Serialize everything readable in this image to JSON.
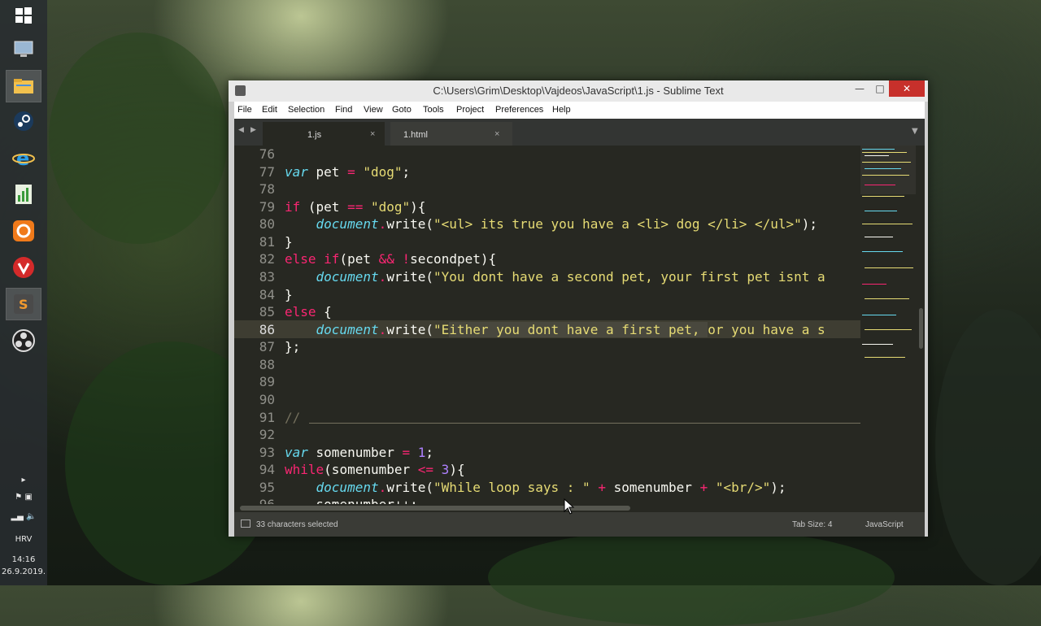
{
  "window": {
    "title": "C:\\Users\\Grim\\Desktop\\Vajdeos\\JavaScript\\1.js - Sublime Text",
    "minimize": "—",
    "maximize": "□",
    "close": "✕"
  },
  "menu": [
    "File",
    "Edit",
    "Selection",
    "Find",
    "View",
    "Goto",
    "Tools",
    "Project",
    "Preferences",
    "Help"
  ],
  "tabs": [
    {
      "label": "1.js",
      "close": "×",
      "active": true
    },
    {
      "label": "1.html",
      "close": "×",
      "active": false
    }
  ],
  "tab_nav": {
    "left": "◀",
    "right": "▶",
    "dropdown": "▼"
  },
  "editor": {
    "line_numbers": [
      "76",
      "77",
      "78",
      "79",
      "80",
      "81",
      "82",
      "83",
      "84",
      "85",
      "86",
      "87",
      "88",
      "89",
      "90",
      "91",
      "92",
      "93",
      "94",
      "95",
      "96"
    ],
    "current_line": "86",
    "selection_info": "33 characters selected"
  },
  "code": {
    "l77": {
      "kw": "var",
      "id": " pet ",
      "op": "=",
      "sp": " ",
      "str": "\"dog\"",
      "end": ";"
    },
    "l79": {
      "kw": "if",
      "a": " (pet ",
      "op": "==",
      "sp": " ",
      "str": "\"dog\"",
      "end": "){"
    },
    "l80": {
      "indent": "    ",
      "obj": "document",
      "dot": ".",
      "fn": "write(",
      "str": "\"<ul> its true you have a <li> dog </li> </ul>\"",
      "end": ");"
    },
    "l81": "}",
    "l82": {
      "kw1": "else",
      "sp": " ",
      "kw2": "if",
      "a": "(pet ",
      "op1": "&&",
      "sp2": " ",
      "op2": "!",
      "b": "secondpet){"
    },
    "l83": {
      "indent": "    ",
      "obj": "document",
      "dot": ".",
      "fn": "write(",
      "str": "\"You dont have a second pet, your first pet isnt a"
    },
    "l84": "}",
    "l85": {
      "kw": "else",
      "end": " {"
    },
    "l86": {
      "indent": "    ",
      "obj": "document",
      "dot": ".",
      "fn": "write(",
      "str_a": "\"E",
      "str_sel": "ither you dont have a first pet, ",
      "str_b": "or you have a s"
    },
    "l87": "};",
    "l91": {
      "cmt": "//"
    },
    "l93": {
      "kw": "var",
      "id": " somenumber ",
      "op": "=",
      "sp": " ",
      "num": "1",
      "end": ";"
    },
    "l94": {
      "kw": "while",
      "a": "(somenumber ",
      "op": "<=",
      "sp": " ",
      "num": "3",
      "end": "){"
    },
    "l95": {
      "indent": "    ",
      "obj": "document",
      "dot": ".",
      "fn": "write(",
      "str1": "\"While loop says : \"",
      "sp1": " ",
      "op1": "+",
      "id": " somenumber ",
      "op2": "+",
      "sp2": " ",
      "str2": "\"<br/>\"",
      "end": ");"
    },
    "l96": {
      "indent": "    ",
      "id": "somenumber++;"
    }
  },
  "status": {
    "selection": "33 characters selected",
    "tab_size": "Tab Size: 4",
    "syntax": "JavaScript"
  },
  "taskbar": {
    "icons": [
      "windows-start-icon",
      "monitor-icon",
      "file-explorer-icon",
      "steam-icon",
      "internet-explorer-icon",
      "sheet-app-icon",
      "hub-app-icon",
      "vivaldi-icon",
      "sublime-text-icon",
      "obs-icon"
    ],
    "language": "HRV",
    "time": "14:16",
    "date": "26.9.2019."
  },
  "colors": {
    "editor_bg": "#272822",
    "keyword": "#66d9ef",
    "control": "#f92672",
    "string": "#e6db74",
    "number": "#ae81ff",
    "comment": "#75715e",
    "close_button": "#c7302b"
  }
}
